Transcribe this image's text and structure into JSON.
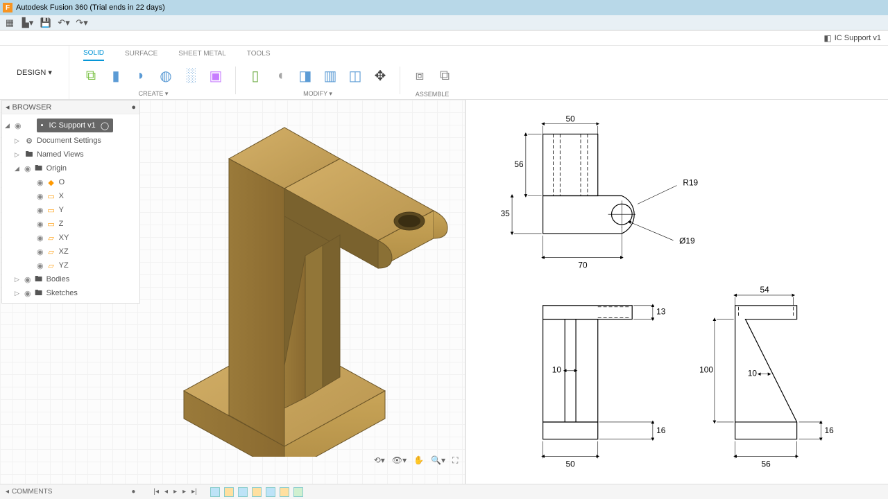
{
  "title": "Autodesk Fusion 360 (Trial ends in 22 days)",
  "doc_tab": "IC Support v1",
  "workspace": "DESIGN ▾",
  "ribbon_tabs": {
    "solid": "SOLID",
    "surface": "SURFACE",
    "sheet_metal": "SHEET METAL",
    "tools": "TOOLS"
  },
  "ribbon_groups": {
    "create": "CREATE ▾",
    "modify": "MODIFY ▾",
    "assemble": "ASSEMBLE"
  },
  "browser": {
    "header": "BROWSER",
    "root": "IC Support v1",
    "doc_settings": "Document Settings",
    "named_views": "Named Views",
    "origin": "Origin",
    "o": "O",
    "x": "X",
    "y": "Y",
    "z": "Z",
    "xy": "XY",
    "xz": "XZ",
    "yz": "YZ",
    "bodies": "Bodies",
    "sketches": "Sketches"
  },
  "comments": "COMMENTS",
  "drawing": {
    "dims": {
      "w50": "50",
      "h56": "56",
      "h35": "35",
      "w70": "70",
      "r19": "R19",
      "d19": "Ø19",
      "w50b": "50",
      "w10": "10",
      "h100": "100",
      "h13": "13",
      "h16": "16",
      "w54": "54",
      "w56": "56",
      "w10b": "10",
      "h16b": "16"
    }
  }
}
